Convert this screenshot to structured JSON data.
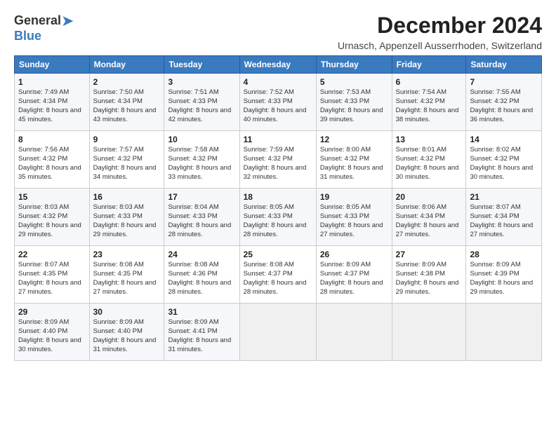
{
  "logo": {
    "general": "General",
    "blue": "Blue"
  },
  "title": "December 2024",
  "location": "Urnasch, Appenzell Ausserrhoden, Switzerland",
  "days_of_week": [
    "Sunday",
    "Monday",
    "Tuesday",
    "Wednesday",
    "Thursday",
    "Friday",
    "Saturday"
  ],
  "weeks": [
    [
      {
        "day": "1",
        "sunrise": "Sunrise: 7:49 AM",
        "sunset": "Sunset: 4:34 PM",
        "daylight": "Daylight: 8 hours and 45 minutes."
      },
      {
        "day": "2",
        "sunrise": "Sunrise: 7:50 AM",
        "sunset": "Sunset: 4:34 PM",
        "daylight": "Daylight: 8 hours and 43 minutes."
      },
      {
        "day": "3",
        "sunrise": "Sunrise: 7:51 AM",
        "sunset": "Sunset: 4:33 PM",
        "daylight": "Daylight: 8 hours and 42 minutes."
      },
      {
        "day": "4",
        "sunrise": "Sunrise: 7:52 AM",
        "sunset": "Sunset: 4:33 PM",
        "daylight": "Daylight: 8 hours and 40 minutes."
      },
      {
        "day": "5",
        "sunrise": "Sunrise: 7:53 AM",
        "sunset": "Sunset: 4:33 PM",
        "daylight": "Daylight: 8 hours and 39 minutes."
      },
      {
        "day": "6",
        "sunrise": "Sunrise: 7:54 AM",
        "sunset": "Sunset: 4:32 PM",
        "daylight": "Daylight: 8 hours and 38 minutes."
      },
      {
        "day": "7",
        "sunrise": "Sunrise: 7:55 AM",
        "sunset": "Sunset: 4:32 PM",
        "daylight": "Daylight: 8 hours and 36 minutes."
      }
    ],
    [
      {
        "day": "8",
        "sunrise": "Sunrise: 7:56 AM",
        "sunset": "Sunset: 4:32 PM",
        "daylight": "Daylight: 8 hours and 35 minutes."
      },
      {
        "day": "9",
        "sunrise": "Sunrise: 7:57 AM",
        "sunset": "Sunset: 4:32 PM",
        "daylight": "Daylight: 8 hours and 34 minutes."
      },
      {
        "day": "10",
        "sunrise": "Sunrise: 7:58 AM",
        "sunset": "Sunset: 4:32 PM",
        "daylight": "Daylight: 8 hours and 33 minutes."
      },
      {
        "day": "11",
        "sunrise": "Sunrise: 7:59 AM",
        "sunset": "Sunset: 4:32 PM",
        "daylight": "Daylight: 8 hours and 32 minutes."
      },
      {
        "day": "12",
        "sunrise": "Sunrise: 8:00 AM",
        "sunset": "Sunset: 4:32 PM",
        "daylight": "Daylight: 8 hours and 31 minutes."
      },
      {
        "day": "13",
        "sunrise": "Sunrise: 8:01 AM",
        "sunset": "Sunset: 4:32 PM",
        "daylight": "Daylight: 8 hours and 30 minutes."
      },
      {
        "day": "14",
        "sunrise": "Sunrise: 8:02 AM",
        "sunset": "Sunset: 4:32 PM",
        "daylight": "Daylight: 8 hours and 30 minutes."
      }
    ],
    [
      {
        "day": "15",
        "sunrise": "Sunrise: 8:03 AM",
        "sunset": "Sunset: 4:32 PM",
        "daylight": "Daylight: 8 hours and 29 minutes."
      },
      {
        "day": "16",
        "sunrise": "Sunrise: 8:03 AM",
        "sunset": "Sunset: 4:33 PM",
        "daylight": "Daylight: 8 hours and 29 minutes."
      },
      {
        "day": "17",
        "sunrise": "Sunrise: 8:04 AM",
        "sunset": "Sunset: 4:33 PM",
        "daylight": "Daylight: 8 hours and 28 minutes."
      },
      {
        "day": "18",
        "sunrise": "Sunrise: 8:05 AM",
        "sunset": "Sunset: 4:33 PM",
        "daylight": "Daylight: 8 hours and 28 minutes."
      },
      {
        "day": "19",
        "sunrise": "Sunrise: 8:05 AM",
        "sunset": "Sunset: 4:33 PM",
        "daylight": "Daylight: 8 hours and 27 minutes."
      },
      {
        "day": "20",
        "sunrise": "Sunrise: 8:06 AM",
        "sunset": "Sunset: 4:34 PM",
        "daylight": "Daylight: 8 hours and 27 minutes."
      },
      {
        "day": "21",
        "sunrise": "Sunrise: 8:07 AM",
        "sunset": "Sunset: 4:34 PM",
        "daylight": "Daylight: 8 hours and 27 minutes."
      }
    ],
    [
      {
        "day": "22",
        "sunrise": "Sunrise: 8:07 AM",
        "sunset": "Sunset: 4:35 PM",
        "daylight": "Daylight: 8 hours and 27 minutes."
      },
      {
        "day": "23",
        "sunrise": "Sunrise: 8:08 AM",
        "sunset": "Sunset: 4:35 PM",
        "daylight": "Daylight: 8 hours and 27 minutes."
      },
      {
        "day": "24",
        "sunrise": "Sunrise: 8:08 AM",
        "sunset": "Sunset: 4:36 PM",
        "daylight": "Daylight: 8 hours and 28 minutes."
      },
      {
        "day": "25",
        "sunrise": "Sunrise: 8:08 AM",
        "sunset": "Sunset: 4:37 PM",
        "daylight": "Daylight: 8 hours and 28 minutes."
      },
      {
        "day": "26",
        "sunrise": "Sunrise: 8:09 AM",
        "sunset": "Sunset: 4:37 PM",
        "daylight": "Daylight: 8 hours and 28 minutes."
      },
      {
        "day": "27",
        "sunrise": "Sunrise: 8:09 AM",
        "sunset": "Sunset: 4:38 PM",
        "daylight": "Daylight: 8 hours and 29 minutes."
      },
      {
        "day": "28",
        "sunrise": "Sunrise: 8:09 AM",
        "sunset": "Sunset: 4:39 PM",
        "daylight": "Daylight: 8 hours and 29 minutes."
      }
    ],
    [
      {
        "day": "29",
        "sunrise": "Sunrise: 8:09 AM",
        "sunset": "Sunset: 4:40 PM",
        "daylight": "Daylight: 8 hours and 30 minutes."
      },
      {
        "day": "30",
        "sunrise": "Sunrise: 8:09 AM",
        "sunset": "Sunset: 4:40 PM",
        "daylight": "Daylight: 8 hours and 31 minutes."
      },
      {
        "day": "31",
        "sunrise": "Sunrise: 8:09 AM",
        "sunset": "Sunset: 4:41 PM",
        "daylight": "Daylight: 8 hours and 31 minutes."
      },
      null,
      null,
      null,
      null
    ]
  ]
}
